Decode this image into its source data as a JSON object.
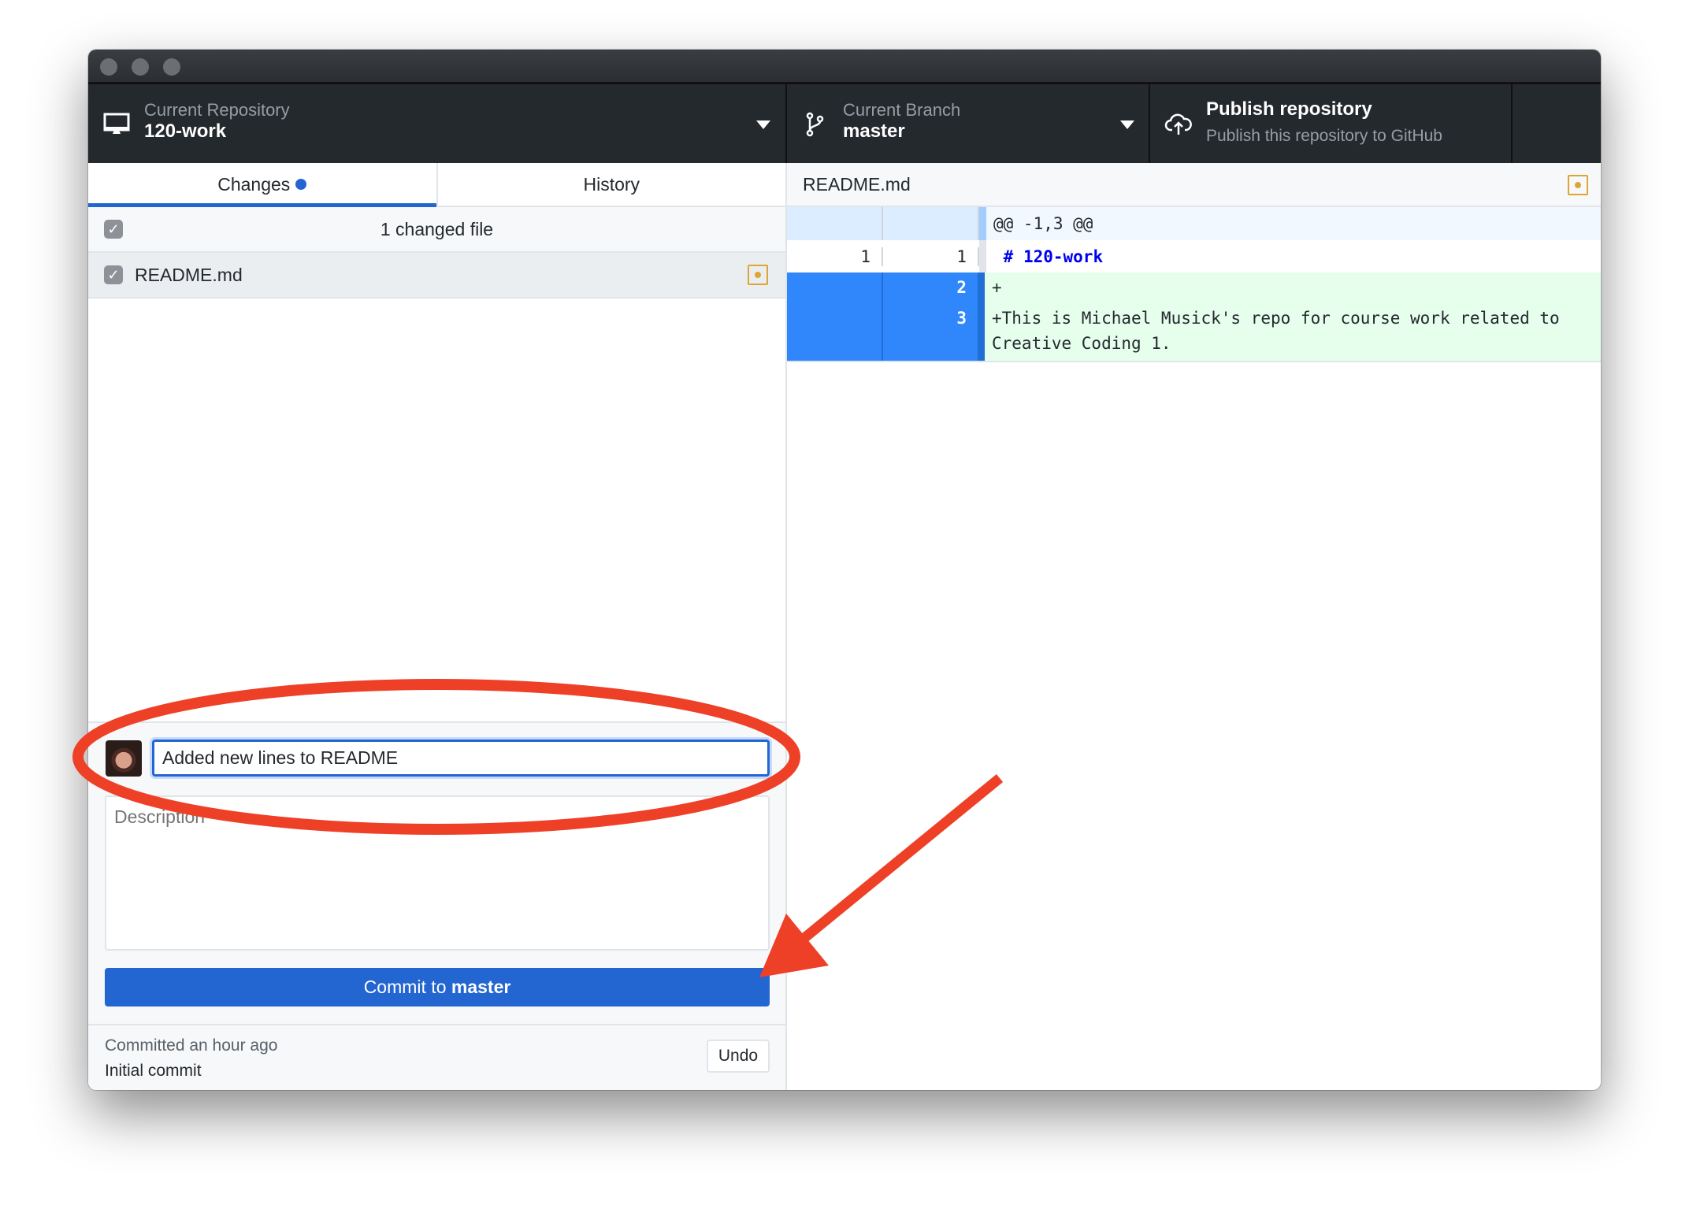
{
  "window": {
    "controls": [
      "close",
      "minimize",
      "zoom"
    ]
  },
  "toolbar": {
    "repo": {
      "label": "Current Repository",
      "value": "120-work",
      "icon": "desktop-icon"
    },
    "branch": {
      "label": "Current Branch",
      "value": "master",
      "icon": "git-branch-icon"
    },
    "publish": {
      "label": "Publish repository",
      "sub": "Publish this repository to GitHub",
      "icon": "cloud-upload-icon"
    }
  },
  "tabs": [
    {
      "label": "Changes",
      "active": true,
      "badge": true
    },
    {
      "label": "History"
    }
  ],
  "changes": {
    "header": "1 changed file",
    "files": [
      {
        "name": "README.md",
        "status": "modified",
        "checked": true
      }
    ]
  },
  "commit": {
    "summary": "Added new lines to README",
    "description_placeholder": "Description",
    "button_prefix": "Commit to ",
    "button_branch": "master"
  },
  "last_commit": {
    "time": "Committed an hour ago",
    "message": "Initial commit",
    "undo": "Undo"
  },
  "diff": {
    "file": "README.md",
    "hunk": "@@ -1,3 @@",
    "lines": [
      {
        "old": "1",
        "new": "1",
        "text": " # 120-work",
        "type": "context"
      },
      {
        "old": "",
        "new": "2",
        "text": "+",
        "type": "added"
      },
      {
        "old": "",
        "new": "3",
        "text": "+This is Michael Musick's repo for course work related to Creative Coding 1.",
        "type": "added"
      }
    ]
  },
  "colors": {
    "accent": "#2366d1",
    "annotation": "#ee4027",
    "modified": "#dca534",
    "added_bg": "#e6ffed"
  }
}
